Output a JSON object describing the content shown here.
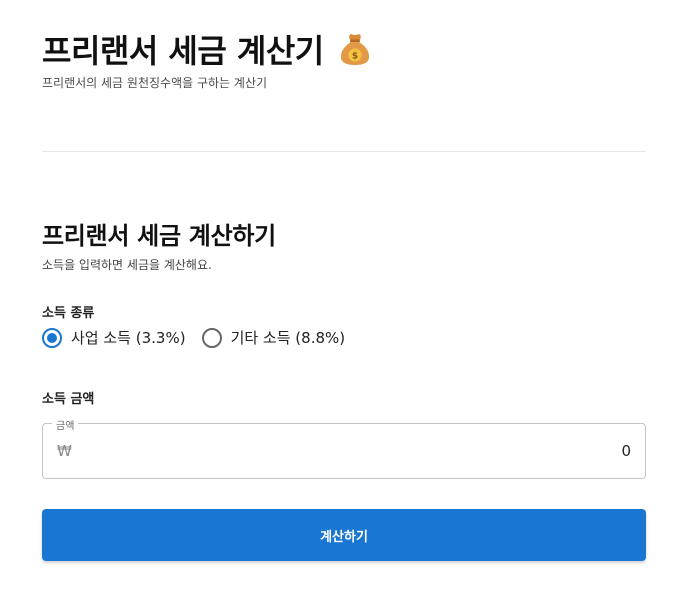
{
  "header": {
    "title": "프리랜서 세금 계산기",
    "icon": "money-bag-icon",
    "subtitle": "프리랜서의 세금 원천징수액을 구하는 계산기"
  },
  "calculator": {
    "title": "프리랜서 세금 계산하기",
    "description": "소득을 입력하면 세금을 계산해요.",
    "income_type": {
      "label": "소득 종류",
      "options": [
        {
          "label": "사업 소득 (3.3%)",
          "selected": true
        },
        {
          "label": "기타 소득 (8.8%)",
          "selected": false
        }
      ]
    },
    "amount": {
      "label": "소득 금액",
      "field_legend": "금액",
      "currency_symbol": "₩",
      "value": "0"
    },
    "submit_label": "계산하기"
  },
  "colors": {
    "accent": "#1976d2",
    "divider": "#e6e6e6"
  }
}
